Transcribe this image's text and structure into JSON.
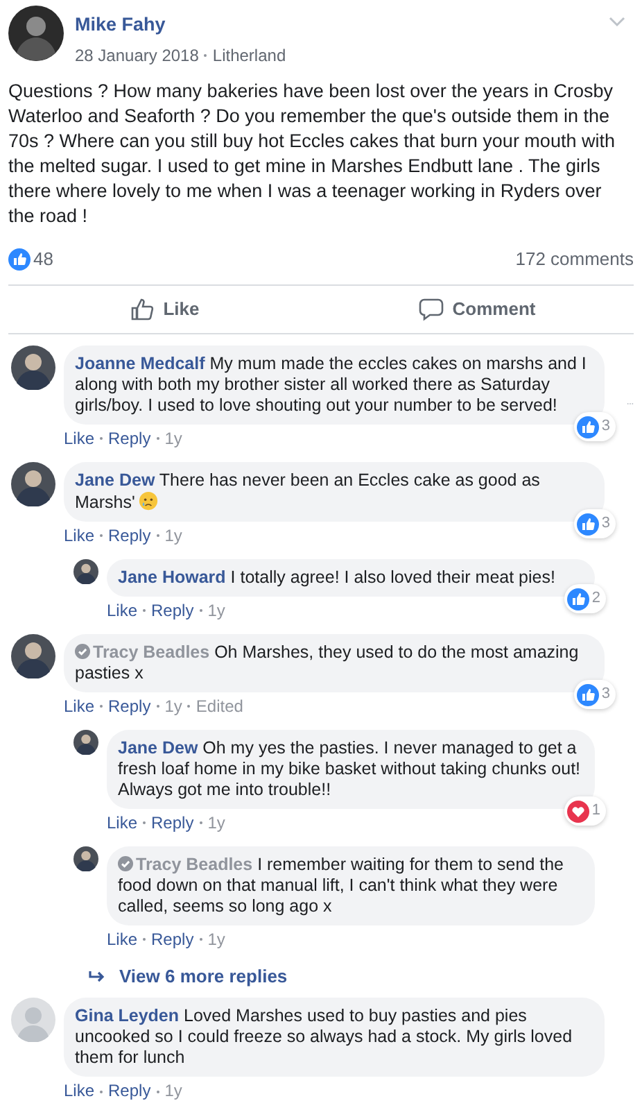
{
  "post": {
    "author": "Mike Fahy",
    "date": "28 January 2018",
    "place": "Litherland",
    "text": "Questions ? How many bakeries have been lost over the years in Crosby Waterloo and Seaforth ? Do you remember the que's outside them in the 70s ? Where can you still buy hot Eccles cakes that burn your mouth with the melted sugar. I used to get mine in Marshes Endbutt lane . The girls there where lovely to me when I was a teenager working in Ryders over the road !",
    "likes": "48",
    "comments": "172 comments",
    "actions": [
      "Like",
      "Comment"
    ]
  },
  "comments": [
    {
      "author": "Joanne Medcalf",
      "badge": false,
      "default_avatar": false,
      "text": "My mum made the eccles cakes on marshs and I along with both my brother sister all worked there as Saturday girls/boy. I used to love shouting out your number to be served!",
      "reaction": {
        "kind": "like",
        "count": "3"
      },
      "menu": true,
      "actions": [
        "Like",
        "Reply",
        "1y"
      ]
    },
    {
      "author": "Jane Dew",
      "badge": false,
      "default_avatar": false,
      "text": "There has never been an Eccles cake as good as Marshs'",
      "sad_emoji": true,
      "reaction": {
        "kind": "like",
        "count": "3"
      },
      "menu": false,
      "actions": [
        "Like",
        "Reply",
        "1y"
      ],
      "children": [
        {
          "author": "Jane Howard",
          "badge": false,
          "default_avatar": false,
          "text": "I totally agree! I also loved their meat pies!",
          "reaction": {
            "kind": "like",
            "count": "2"
          },
          "menu": false,
          "actions": [
            "Like",
            "Reply",
            "1y"
          ]
        }
      ]
    },
    {
      "author": "Tracy Beadles",
      "badge": true,
      "default_avatar": false,
      "text": "Oh Marshes, they used to do the most amazing pasties x",
      "reaction": {
        "kind": "like",
        "count": "3"
      },
      "menu": false,
      "actions": [
        "Like",
        "Reply",
        "1y",
        "Edited"
      ],
      "children": [
        {
          "author": "Jane Dew",
          "badge": false,
          "default_avatar": false,
          "text": "Oh my yes the pasties. I never managed to get a fresh loaf home in my bike basket without taking chunks out! Always got me into trouble!!",
          "reaction": {
            "kind": "love",
            "count": "1"
          },
          "menu": false,
          "actions": [
            "Like",
            "Reply",
            "1y"
          ]
        },
        {
          "author": "Tracy Beadles",
          "badge": true,
          "default_avatar": false,
          "text": "I remember waiting for them to send the food down on that manual lift, I can't think what they were called, seems so long ago x",
          "menu": false,
          "actions": [
            "Like",
            "Reply",
            "1y"
          ]
        }
      ],
      "more": "View 6 more replies"
    },
    {
      "author": "Gina Leyden",
      "badge": false,
      "default_avatar": true,
      "text": "Loved Marshes used to buy pasties and pies uncooked so I could freeze so always had a stock. My girls loved them for lunch",
      "menu": false,
      "actions": [
        "Like",
        "Reply",
        "1y"
      ]
    }
  ]
}
